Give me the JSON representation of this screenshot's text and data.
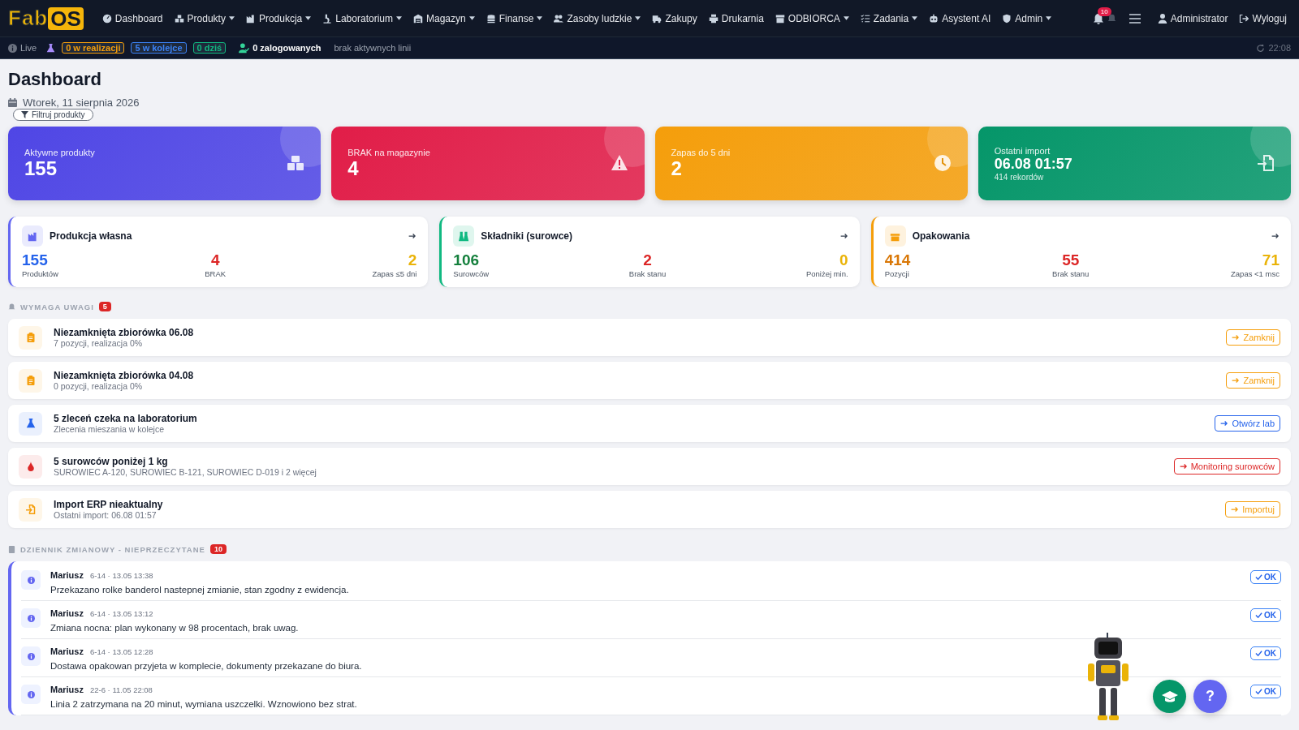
{
  "navbar": {
    "brand": {
      "part1": "Fab",
      "part2": "OS"
    },
    "items": [
      {
        "label": "Dashboard",
        "dropdown": false
      },
      {
        "label": "Produkty",
        "dropdown": true
      },
      {
        "label": "Produkcja",
        "dropdown": true
      },
      {
        "label": "Laboratorium",
        "dropdown": true
      },
      {
        "label": "Magazyn",
        "dropdown": true
      },
      {
        "label": "Finanse",
        "dropdown": true
      },
      {
        "label": "Zasoby ludzkie",
        "dropdown": true
      },
      {
        "label": "Zakupy",
        "dropdown": false
      },
      {
        "label": "Drukarnia",
        "dropdown": false
      },
      {
        "label": "ODBIORCA",
        "dropdown": true
      },
      {
        "label": "Zadania",
        "dropdown": true
      },
      {
        "label": "Asystent AI",
        "dropdown": false
      },
      {
        "label": "Admin",
        "dropdown": true
      }
    ],
    "notifications": "10",
    "user": "Administrator",
    "logout": "Wyloguj"
  },
  "status_bar": {
    "live": "Live",
    "badges": [
      {
        "text": "0 w realizacji",
        "color": "#f59e0b"
      },
      {
        "text": "5 w kolejce",
        "color": "#3b82f6"
      },
      {
        "text": "0 dziś",
        "color": "#10b981"
      }
    ],
    "logged_in": "0 zalogowanych",
    "lines": "brak aktywnych linii",
    "time": "22:08"
  },
  "header": {
    "title": "Dashboard",
    "date": "Wtorek, 11 sierpnia 2026",
    "filter_button": "Filtruj produkty"
  },
  "kpi_cards": [
    {
      "label": "Aktywne produkty",
      "value": "155",
      "color": "#4f46e5"
    },
    {
      "label": "BRAK na magazynie",
      "value": "4",
      "color": "#e11d48"
    },
    {
      "label": "Zapas do 5 dni",
      "value": "2",
      "color": "#f59e0b"
    },
    {
      "label": "Ostatni import",
      "value": "06.08 01:57",
      "sub": "414 rekordów",
      "color": "#059669"
    }
  ],
  "summary_cards": [
    {
      "title": "Produkcja własna",
      "color": "#6366f1",
      "stats": [
        {
          "value": "155",
          "label": "Produktów",
          "color": "#2563eb"
        },
        {
          "value": "4",
          "label": "BRAK",
          "color": "#dc2626"
        },
        {
          "value": "2",
          "label": "Zapas ≤5 dni",
          "color": "#eab308"
        }
      ]
    },
    {
      "title": "Składniki (surowce)",
      "color": "#10b981",
      "stats": [
        {
          "value": "106",
          "label": "Surowców",
          "color": "#15803d"
        },
        {
          "value": "2",
          "label": "Brak stanu",
          "color": "#dc2626"
        },
        {
          "value": "0",
          "label": "Poniżej min.",
          "color": "#eab308"
        }
      ]
    },
    {
      "title": "Opakowania",
      "color": "#f59e0b",
      "stats": [
        {
          "value": "414",
          "label": "Pozycji",
          "color": "#d97706"
        },
        {
          "value": "55",
          "label": "Brak stanu",
          "color": "#dc2626"
        },
        {
          "value": "71",
          "label": "Zapas <1 msc",
          "color": "#eab308"
        }
      ]
    }
  ],
  "attention": {
    "title": "WYMAGA UWAGI",
    "count": "5",
    "items": [
      {
        "kind": "clipboard",
        "title": "Niezamknięta zbiorówka 06.08",
        "subtitle": "7 pozycji, realizacja 0%",
        "action": "Zamknij",
        "color": "#f59e0b"
      },
      {
        "kind": "clipboard",
        "title": "Niezamknięta zbiorówka 04.08",
        "subtitle": "0 pozycji, realizacja 0%",
        "action": "Zamknij",
        "color": "#f59e0b"
      },
      {
        "kind": "flask",
        "title": "5 zleceń czeka na laboratorium",
        "subtitle": "Zlecenia mieszania w kolejce",
        "action": "Otwórz lab",
        "color": "#2563eb"
      },
      {
        "kind": "drop",
        "title": "5 surowców poniżej 1 kg",
        "subtitle": "SUROWIEC A-120, SUROWIEC B-121, SUROWIEC D-019 i 2 więcej",
        "action": "Monitoring surowców",
        "color": "#dc2626"
      },
      {
        "kind": "import",
        "title": "Import ERP nieaktualny",
        "subtitle": "Ostatni import: 06.08 01:57",
        "action": "Importuj",
        "color": "#f59e0b"
      }
    ]
  },
  "shift_log": {
    "title": "DZIENNIK ZMIANOWY - NIEPRZECZYTANE",
    "count": "10",
    "entries": [
      {
        "author": "Mariusz",
        "meta": "6-14 · 13.05 13:38",
        "text": "Przekazano rolke banderol nastepnej zmianie, stan zgodny z ewidencja.",
        "button": "OK"
      },
      {
        "author": "Mariusz",
        "meta": "6-14 · 13.05 13:12",
        "text": "Zmiana nocna: plan wykonany w 98 procentach, brak uwag.",
        "button": "OK"
      },
      {
        "author": "Mariusz",
        "meta": "6-14 · 13.05 12:28",
        "text": "Dostawa opakowan przyjeta w komplecie, dokumenty przekazane do biura.",
        "button": "OK"
      },
      {
        "author": "Mariusz",
        "meta": "22-6 · 11.05 22:08",
        "text": "Linia 2 zatrzymana na 20 minut, wymiana uszczelki. Wznowiono bez strat.",
        "button": "OK"
      }
    ]
  },
  "help_button": "?"
}
